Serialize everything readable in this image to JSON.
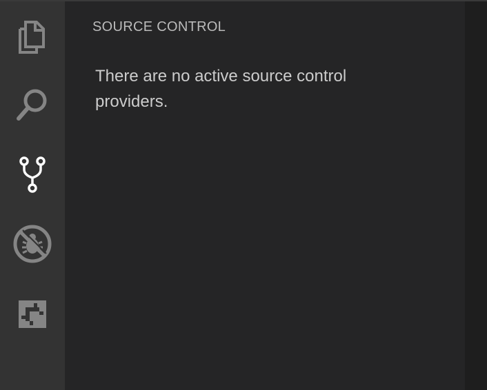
{
  "activity_bar": {
    "items": [
      {
        "icon": "explorer-files-icon",
        "active": false
      },
      {
        "icon": "search-icon",
        "active": false
      },
      {
        "icon": "source-control-icon",
        "active": true
      },
      {
        "icon": "debug-disabled-icon",
        "active": false
      },
      {
        "icon": "extensions-icon",
        "active": false
      }
    ]
  },
  "sidebar": {
    "title": "SOURCE CONTROL",
    "empty_message": "There are no active source control providers."
  },
  "colors": {
    "activity_bar_bg": "#333333",
    "sidebar_bg": "#252526",
    "editor_bg": "#1e1e1e",
    "inactive_icon": "#858585",
    "active_icon": "#ffffff",
    "text": "#cccccc"
  }
}
